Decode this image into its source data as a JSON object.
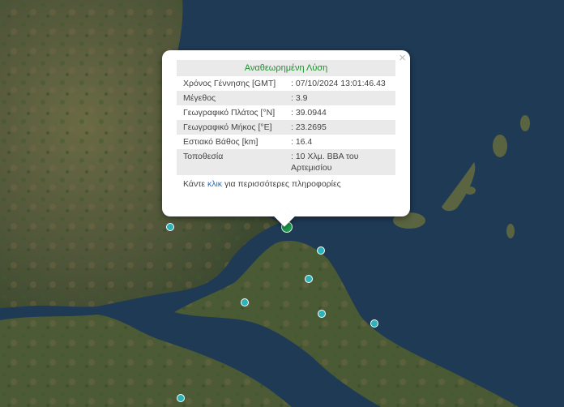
{
  "popup": {
    "title": "Αναθεωρημένη Λύση",
    "close_symbol": "×",
    "rows": [
      {
        "label": "Χρόνος Γέννησης [GMT]",
        "value": ": 07/10/2024 13:01:46.43"
      },
      {
        "label": "Μέγεθος",
        "value": ": 3.9"
      },
      {
        "label": "Γεωγραφικό Πλάτος [°N]",
        "value": ": 39.0944"
      },
      {
        "label": "Γεωγραφικό Μήκος [°E]",
        "value": ": 23.2695"
      },
      {
        "label": "Εστιακό Βάθος [km]",
        "value": ": 16.4"
      },
      {
        "label": "Τοποθεσία",
        "value": ": 10 Χλμ. ΒΒΑ του Αρτεμισίου"
      }
    ],
    "more_prefix": "Κάντε ",
    "more_link": "κλικ",
    "more_suffix": " για περισσότερες πληροφορίες"
  },
  "colors": {
    "sea": "#1f3a55",
    "land": "#5a5a3c",
    "marker_small": "#2bb3b8",
    "marker_main": "#1c9d4c",
    "title_green": "#1d8f2c",
    "link_blue": "#1a72c9"
  }
}
